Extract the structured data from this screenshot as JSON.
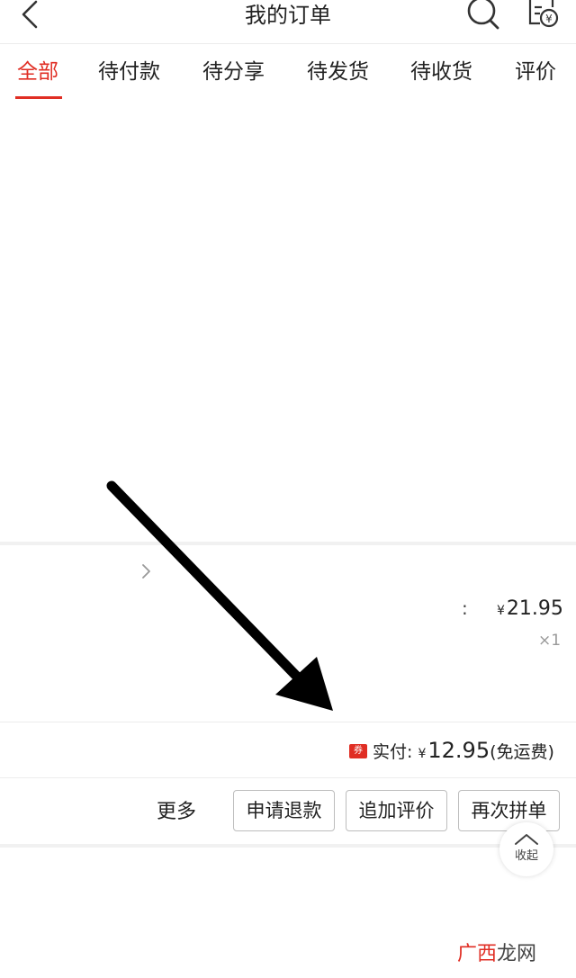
{
  "header": {
    "title": "我的订单",
    "back_icon": "chevron-left-icon",
    "search_icon": "search-icon",
    "bill_icon": "receipt-yen-icon"
  },
  "tabs": [
    {
      "label": "全部",
      "active": true
    },
    {
      "label": "待付款",
      "active": false
    },
    {
      "label": "待分享",
      "active": false
    },
    {
      "label": "待发货",
      "active": false
    },
    {
      "label": "待收货",
      "active": false
    },
    {
      "label": "评价",
      "active": false
    }
  ],
  "order": {
    "price_currency": "¥",
    "price_value": "21.95",
    "quantity": "×1",
    "coupon_badge": "券",
    "paid_label": "实付:",
    "paid_currency": "¥",
    "paid_amount": "12.95",
    "shipping_note": "(免运费)",
    "actions": {
      "more": "更多",
      "refund": "申请退款",
      "add_review": "追加评价",
      "rebuy": "再次拼单"
    },
    "collapse_label": "收起"
  },
  "watermark": {
    "part1": "广西",
    "part2": "龙网"
  },
  "colors": {
    "accent": "#e02e24",
    "annotation_arrow": "#000000"
  }
}
